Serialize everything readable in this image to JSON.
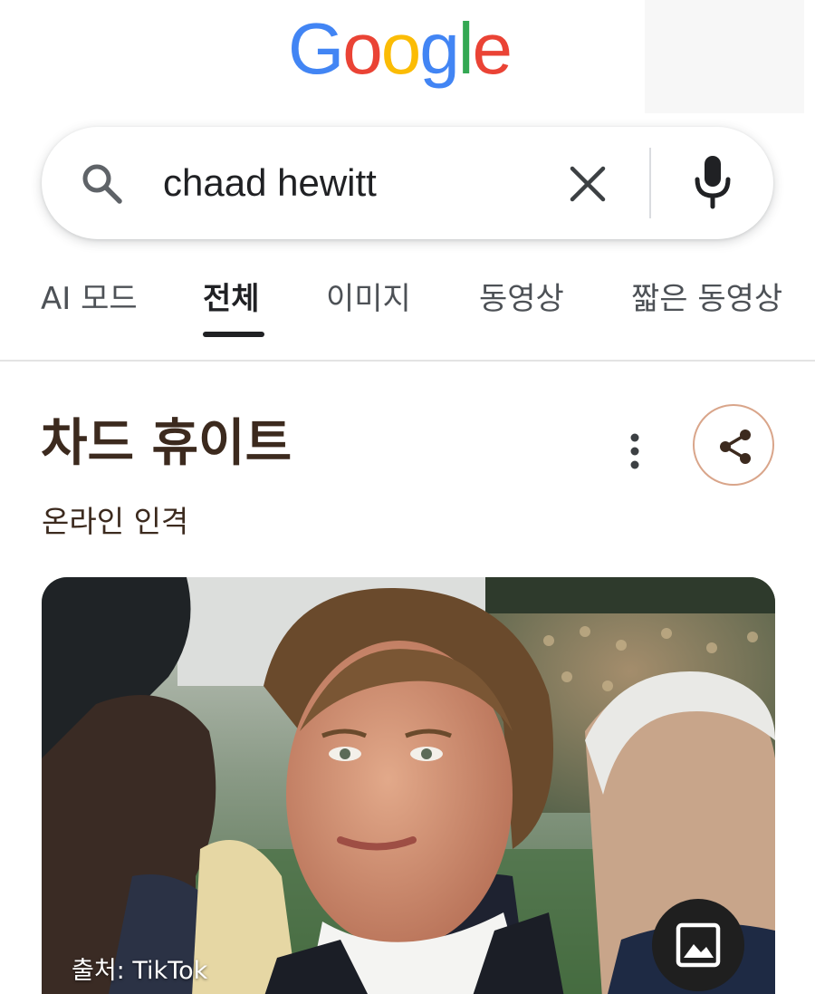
{
  "logo": {
    "letters": [
      "G",
      "o",
      "o",
      "g",
      "l",
      "e"
    ],
    "colors": [
      "#4285F4",
      "#EA4335",
      "#FBBC05",
      "#4285F4",
      "#34A853",
      "#EA4335"
    ]
  },
  "search": {
    "query": "chaad hewitt",
    "icon": "search-icon",
    "clear_icon": "close-icon",
    "mic_icon": "microphone-icon"
  },
  "tabs": [
    {
      "label": "AI 모드",
      "active": false
    },
    {
      "label": "전체",
      "active": true
    },
    {
      "label": "이미지",
      "active": false
    },
    {
      "label": "동영상",
      "active": false
    },
    {
      "label": "짧은 동영상",
      "active": false
    }
  ],
  "entity": {
    "title": "차드 휴이트",
    "subtitle": "온라인 인격",
    "more_icon": "more-vertical-icon",
    "share_icon": "share-icon",
    "accent_color": "#d9a58a"
  },
  "image": {
    "source": "출처: TikTok",
    "button_icon": "image-icon"
  }
}
